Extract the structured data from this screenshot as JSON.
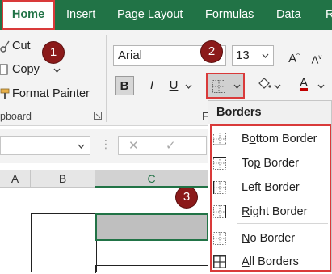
{
  "tabs": [
    {
      "label": "Home",
      "active": true
    },
    {
      "label": "Insert"
    },
    {
      "label": "Page Layout"
    },
    {
      "label": "Formulas"
    },
    {
      "label": "Data"
    },
    {
      "label": "R"
    }
  ],
  "clipboard": {
    "cut": "Cut",
    "copy": "Copy",
    "format_painter": "Format Painter",
    "group_label": "pboard"
  },
  "font": {
    "name": "Arial",
    "size": "13",
    "grow_label": "A",
    "shrink_label": "A",
    "bold": "B",
    "italic": "I",
    "underline": "U",
    "font_color": "A",
    "group_label": "F"
  },
  "steps": [
    "1",
    "2",
    "3"
  ],
  "formula_bar": {
    "name_box": "",
    "cancel": "✕",
    "enter": "✓"
  },
  "columns": [
    "A",
    "B",
    "C"
  ],
  "borders_menu": {
    "header": "Borders",
    "items": [
      {
        "pre": "B",
        "accel": "o",
        "post": "ttom Border"
      },
      {
        "pre": "To",
        "accel": "p",
        "post": " Border"
      },
      {
        "pre": "",
        "accel": "L",
        "post": "eft Border"
      },
      {
        "pre": "",
        "accel": "R",
        "post": "ight Border"
      },
      {
        "pre": "",
        "accel": "N",
        "post": "o Border"
      },
      {
        "pre": "",
        "accel": "A",
        "post": "ll Borders"
      }
    ]
  },
  "colors": {
    "excel_green": "#217346",
    "highlight_red": "#d93a3a",
    "step_maroon": "#8b1a1a",
    "font_color_bar": "#c00000"
  }
}
